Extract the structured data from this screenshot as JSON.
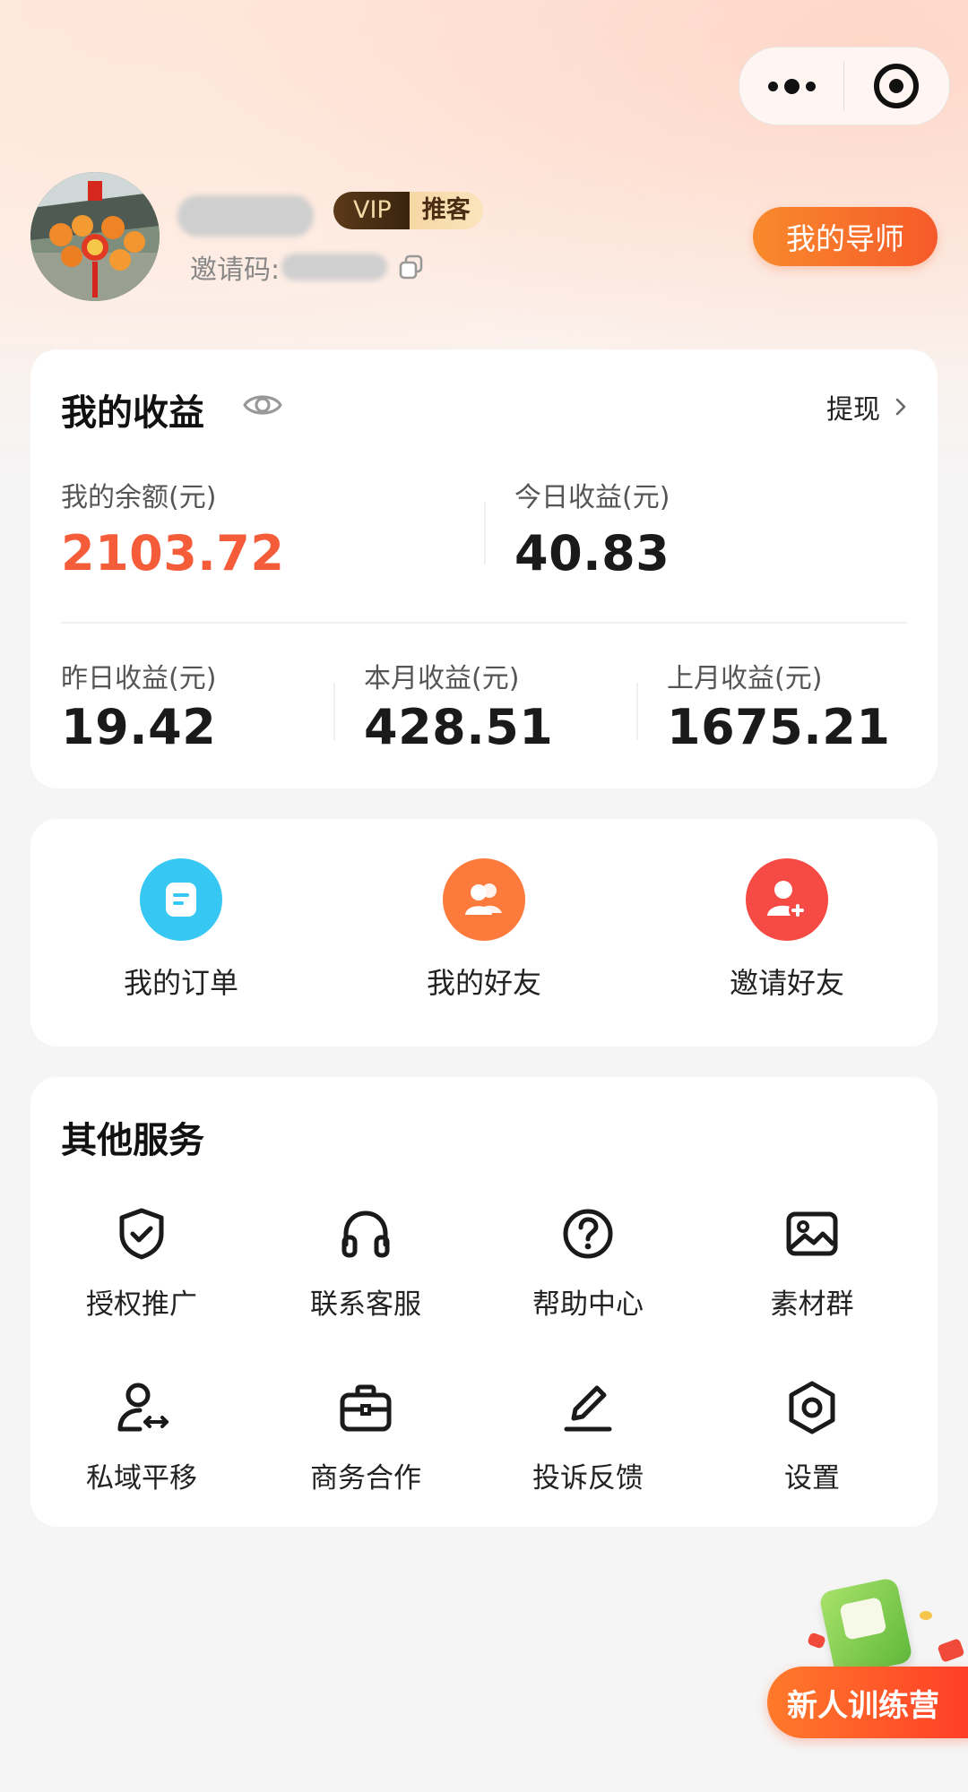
{
  "profile": {
    "vip_label": "VIP",
    "role_tag": "推客",
    "invite_prefix": "邀请码:",
    "mentor_button": "我的导师"
  },
  "earnings": {
    "title": "我的收益",
    "withdraw": "提现",
    "balance_label": "我的余额(元)",
    "balance_value": "2103.72",
    "today_label": "今日收益(元)",
    "today_value": "40.83",
    "yesterday_label": "昨日收益(元)",
    "yesterday_value": "19.42",
    "month_label": "本月收益(元)",
    "month_value": "428.51",
    "last_month_label": "上月收益(元)",
    "last_month_value": "1675.21"
  },
  "quick_actions": [
    {
      "label": "我的订单",
      "icon": "order-icon",
      "color": "#36c8f2"
    },
    {
      "label": "我的好友",
      "icon": "friends-icon",
      "color": "#fb7a3c"
    },
    {
      "label": "邀请好友",
      "icon": "invite-user-icon",
      "color": "#f64b44"
    }
  ],
  "services": {
    "title": "其他服务",
    "items": [
      {
        "label": "授权推广",
        "icon": "shield-check-icon"
      },
      {
        "label": "联系客服",
        "icon": "headphones-icon"
      },
      {
        "label": "帮助中心",
        "icon": "help-circle-icon"
      },
      {
        "label": "素材群",
        "icon": "image-icon"
      },
      {
        "label": "私域平移",
        "icon": "user-transfer-icon"
      },
      {
        "label": "商务合作",
        "icon": "briefcase-icon"
      },
      {
        "label": "投诉反馈",
        "icon": "pen-icon"
      },
      {
        "label": "设置",
        "icon": "settings-hexagon-icon"
      }
    ]
  },
  "float": {
    "label": "新人训练营"
  },
  "colors": {
    "accent_orange": "#f7702b",
    "balance_red": "#f45c3a"
  }
}
